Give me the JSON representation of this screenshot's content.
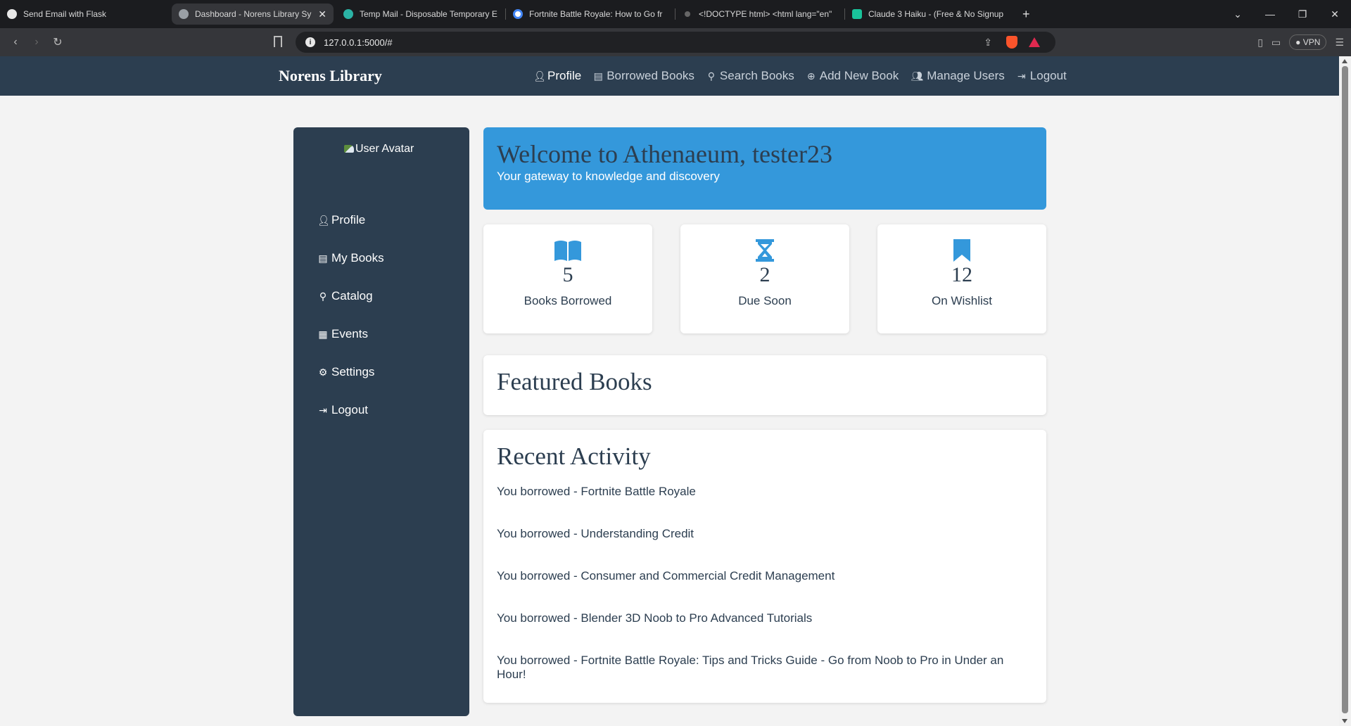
{
  "browser": {
    "tabs": [
      {
        "label": "Send Email with Flask",
        "favicon": "chatgpt-icon"
      },
      {
        "label": "Dashboard - Norens Library Sy",
        "favicon": "globe-icon",
        "active": true
      },
      {
        "label": "Temp Mail - Disposable Temporary E",
        "favicon": "tempmail-icon"
      },
      {
        "label": "Fortnite Battle Royale: How to Go fr",
        "favicon": "google-icon"
      },
      {
        "label": "<!DOCTYPE html> <html lang=\"en\"",
        "favicon": "dot-icon"
      },
      {
        "label": "Claude 3 Haiku - (Free & No Signup",
        "favicon": "chat-icon"
      }
    ],
    "url": "127.0.0.1:5000/#",
    "vpn_label": "VPN"
  },
  "navbar": {
    "brand": "Norens Library",
    "items": [
      {
        "label": "Profile",
        "icon": "user-icon"
      },
      {
        "label": "Borrowed Books",
        "icon": "book-icon"
      },
      {
        "label": "Search Books",
        "icon": "search-icon"
      },
      {
        "label": "Add New Book",
        "icon": "plus-circle-icon"
      },
      {
        "label": "Manage Users",
        "icon": "users-icon"
      },
      {
        "label": "Logout",
        "icon": "sign-out-icon"
      }
    ]
  },
  "sidebar": {
    "avatar_alt": "User Avatar",
    "items": [
      {
        "label": "Profile",
        "icon": "user-icon"
      },
      {
        "label": "My Books",
        "icon": "book-icon"
      },
      {
        "label": "Catalog",
        "icon": "search-icon"
      },
      {
        "label": "Events",
        "icon": "calendar-icon"
      },
      {
        "label": "Settings",
        "icon": "gear-icon"
      },
      {
        "label": "Logout",
        "icon": "sign-out-icon"
      }
    ]
  },
  "welcome": {
    "title": "Welcome to Athenaeum, tester23",
    "subtitle": "Your gateway to knowledge and discovery"
  },
  "stats": [
    {
      "value": "5",
      "label": "Books Borrowed",
      "icon": "open-book-icon"
    },
    {
      "value": "2",
      "label": "Due Soon",
      "icon": "hourglass-icon"
    },
    {
      "value": "12",
      "label": "On Wishlist",
      "icon": "bookmark-icon"
    }
  ],
  "featured": {
    "title": "Featured Books"
  },
  "activity": {
    "title": "Recent Activity",
    "items": [
      "You borrowed - Fortnite Battle Royale",
      "You borrowed - Understanding Credit",
      "You borrowed - Consumer and Commercial Credit Management",
      "You borrowed - Blender 3D Noob to Pro Advanced Tutorials",
      "You borrowed - Fortnite Battle Royale: Tips and Tricks Guide - Go from Noob to Pro in Under an Hour!"
    ]
  },
  "colors": {
    "navbar": "#2c3e50",
    "accent": "#3498db",
    "text_dark": "#2c3e50"
  }
}
